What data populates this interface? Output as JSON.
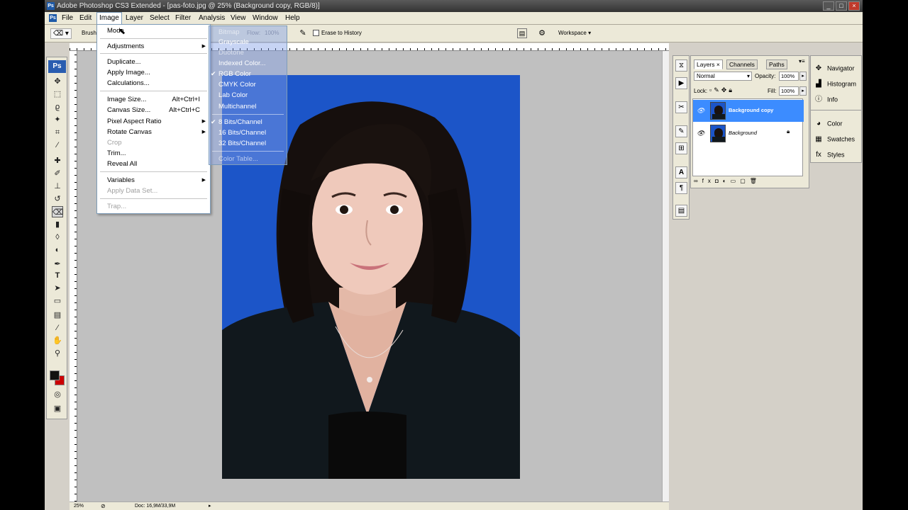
{
  "window": {
    "title": "Adobe Photoshop CS3 Extended - [pas-foto.jpg @ 25% (Background copy, RGB/8)]",
    "app_icon": "Ps",
    "controls": [
      "_",
      "□",
      "×"
    ]
  },
  "menubar": {
    "items": [
      "File",
      "Edit",
      "Image",
      "Layer",
      "Select",
      "Filter",
      "Analysis",
      "View",
      "Window",
      "Help"
    ],
    "active": "Image"
  },
  "optionsbar": {
    "brush_label": "Brush",
    "erase_history_label": "Erase to History",
    "workspace_label": "Workspace ▾",
    "flow_label": "Flow:",
    "flow_value": "100%"
  },
  "image_menu": {
    "items": [
      {
        "label": "Mode",
        "submenu": true
      },
      {
        "label": "Adjustments",
        "submenu": true
      },
      {
        "label": "Duplicate..."
      },
      {
        "label": "Apply Image..."
      },
      {
        "label": "Calculations..."
      },
      {
        "label": "Image Size...",
        "shortcut": "Alt+Ctrl+I"
      },
      {
        "label": "Canvas Size...",
        "shortcut": "Alt+Ctrl+C"
      },
      {
        "label": "Pixel Aspect Ratio",
        "submenu": true
      },
      {
        "label": "Rotate Canvas",
        "submenu": true
      },
      {
        "label": "Crop",
        "disabled": true
      },
      {
        "label": "Trim..."
      },
      {
        "label": "Reveal All"
      },
      {
        "label": "Variables",
        "submenu": true
      },
      {
        "label": "Apply Data Set...",
        "disabled": true
      },
      {
        "label": "Trap...",
        "disabled": true
      }
    ]
  },
  "mode_submenu": {
    "items": [
      {
        "label": "Bitmap",
        "disabled": true
      },
      {
        "label": "Grayscale"
      },
      {
        "label": "Duotone",
        "disabled": true
      },
      {
        "label": "Indexed Color..."
      },
      {
        "label": "RGB Color",
        "checked": true
      },
      {
        "label": "CMYK Color"
      },
      {
        "label": "Lab Color"
      },
      {
        "label": "Multichannel"
      },
      {
        "label": "8 Bits/Channel",
        "checked": true
      },
      {
        "label": "16 Bits/Channel"
      },
      {
        "label": "32 Bits/Channel"
      },
      {
        "label": "Color Table...",
        "disabled": true
      }
    ]
  },
  "layers_panel": {
    "tabs": [
      "Layers ×",
      "Channels",
      "Paths"
    ],
    "blend_mode": "Normal",
    "opacity_label": "Opacity:",
    "opacity_value": "100%",
    "lock_label": "Lock:",
    "fill_label": "Fill:",
    "fill_value": "100%",
    "layers": [
      {
        "name": "Background copy",
        "selected": true
      },
      {
        "name": "Background",
        "locked": true
      }
    ]
  },
  "right_panel": {
    "items": [
      {
        "label": "Navigator",
        "icon": "navigator-icon"
      },
      {
        "label": "Histogram",
        "icon": "histogram-icon"
      },
      {
        "label": "Info",
        "icon": "info-icon"
      },
      {
        "label": "Color",
        "icon": "color-icon"
      },
      {
        "label": "Swatches",
        "icon": "swatches-icon"
      },
      {
        "label": "Styles",
        "icon": "styles-icon"
      }
    ]
  },
  "status": {
    "zoom": "25%",
    "doc": "Doc: 16,9M/33,9M"
  },
  "colors": {
    "photo_background": "#1c55c8",
    "selected_layer": "#3c8cff",
    "foreground": "#111111",
    "background": "#cc0000"
  }
}
